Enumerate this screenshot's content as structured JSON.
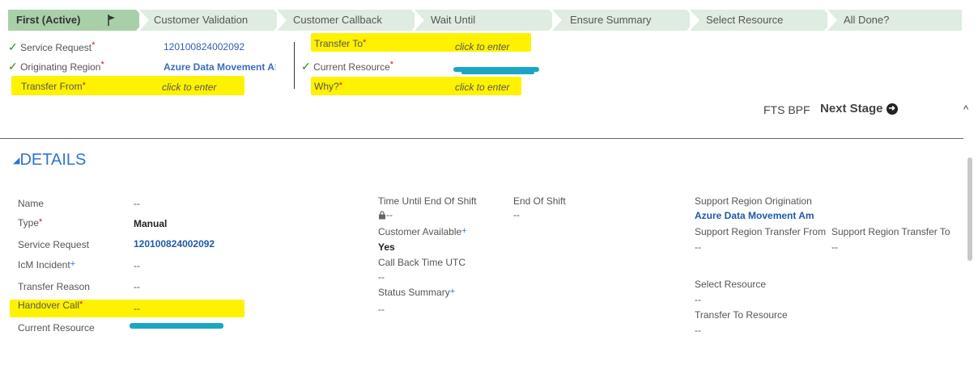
{
  "stages": [
    {
      "label": "First (Active)"
    },
    {
      "label": "Customer Validation"
    },
    {
      "label": "Customer Callback"
    },
    {
      "label": "Wait Until"
    },
    {
      "label": "Ensure Summary"
    },
    {
      "label": "Select Resource"
    },
    {
      "label": "All Done?"
    }
  ],
  "stage_fields_left": [
    {
      "label": "Service Request",
      "value": "120100824002092"
    },
    {
      "label": "Originating Region",
      "value": "Azure Data Movement A"
    },
    {
      "label": "Transfer From",
      "value": "click to enter"
    }
  ],
  "stage_fields_right": [
    {
      "label": "Transfer To",
      "value": "click to enter"
    },
    {
      "label": "Current Resource",
      "value": ""
    },
    {
      "label": "Why?",
      "value": "click to enter"
    }
  ],
  "required_mark": "*",
  "optional_mark": "+",
  "checkmark": "✓",
  "bpf_label": "FTS BPF",
  "next_stage_label": "Next Stage",
  "details": {
    "title": "DETAILS",
    "col1": [
      {
        "label": "Name",
        "value": "--"
      },
      {
        "label": "Type",
        "value": "Manual"
      },
      {
        "label": "Service Request",
        "value": "120100824002092"
      },
      {
        "label": "IcM Incident",
        "value": "--"
      },
      {
        "label": "Transfer Reason",
        "value": "--"
      },
      {
        "label": "Handover Call",
        "value": "--"
      },
      {
        "label": "Current Resource",
        "value": ""
      }
    ],
    "col2": {
      "time_until_end_label": "Time Until End Of Shift",
      "time_until_end_value": "--",
      "end_of_shift_label": "End Of Shift",
      "end_of_shift_value": "--",
      "customer_available_label": "Customer Available",
      "customer_available_value": "Yes",
      "call_back_label": "Call Back Time UTC",
      "call_back_value": "--",
      "status_summary_label": "Status Summary",
      "status_summary_value": "--"
    },
    "col3": {
      "support_region_origination_label": "Support Region Origination",
      "support_region_origination_value": "Azure Data Movement Am",
      "transfer_from_label": "Support Region Transfer From",
      "transfer_from_value": "--",
      "transfer_to_label": "Support Region Transfer To",
      "transfer_to_value": "--",
      "select_resource_label": "Select Resource",
      "select_resource_value": "--",
      "transfer_to_resource_label": "Transfer To Resource",
      "transfer_to_resource_value": "--"
    }
  },
  "colors": {
    "active_stage": "#a9cfa9",
    "stage": "#dfece0",
    "highlight": "#fff200",
    "link": "#2f74d0",
    "required": "#d01818"
  },
  "icons": [
    "flag-icon",
    "check-icon",
    "lock-icon",
    "arrow-right-circle-icon",
    "collapse-caret-icon",
    "chevron-up-icon"
  ]
}
